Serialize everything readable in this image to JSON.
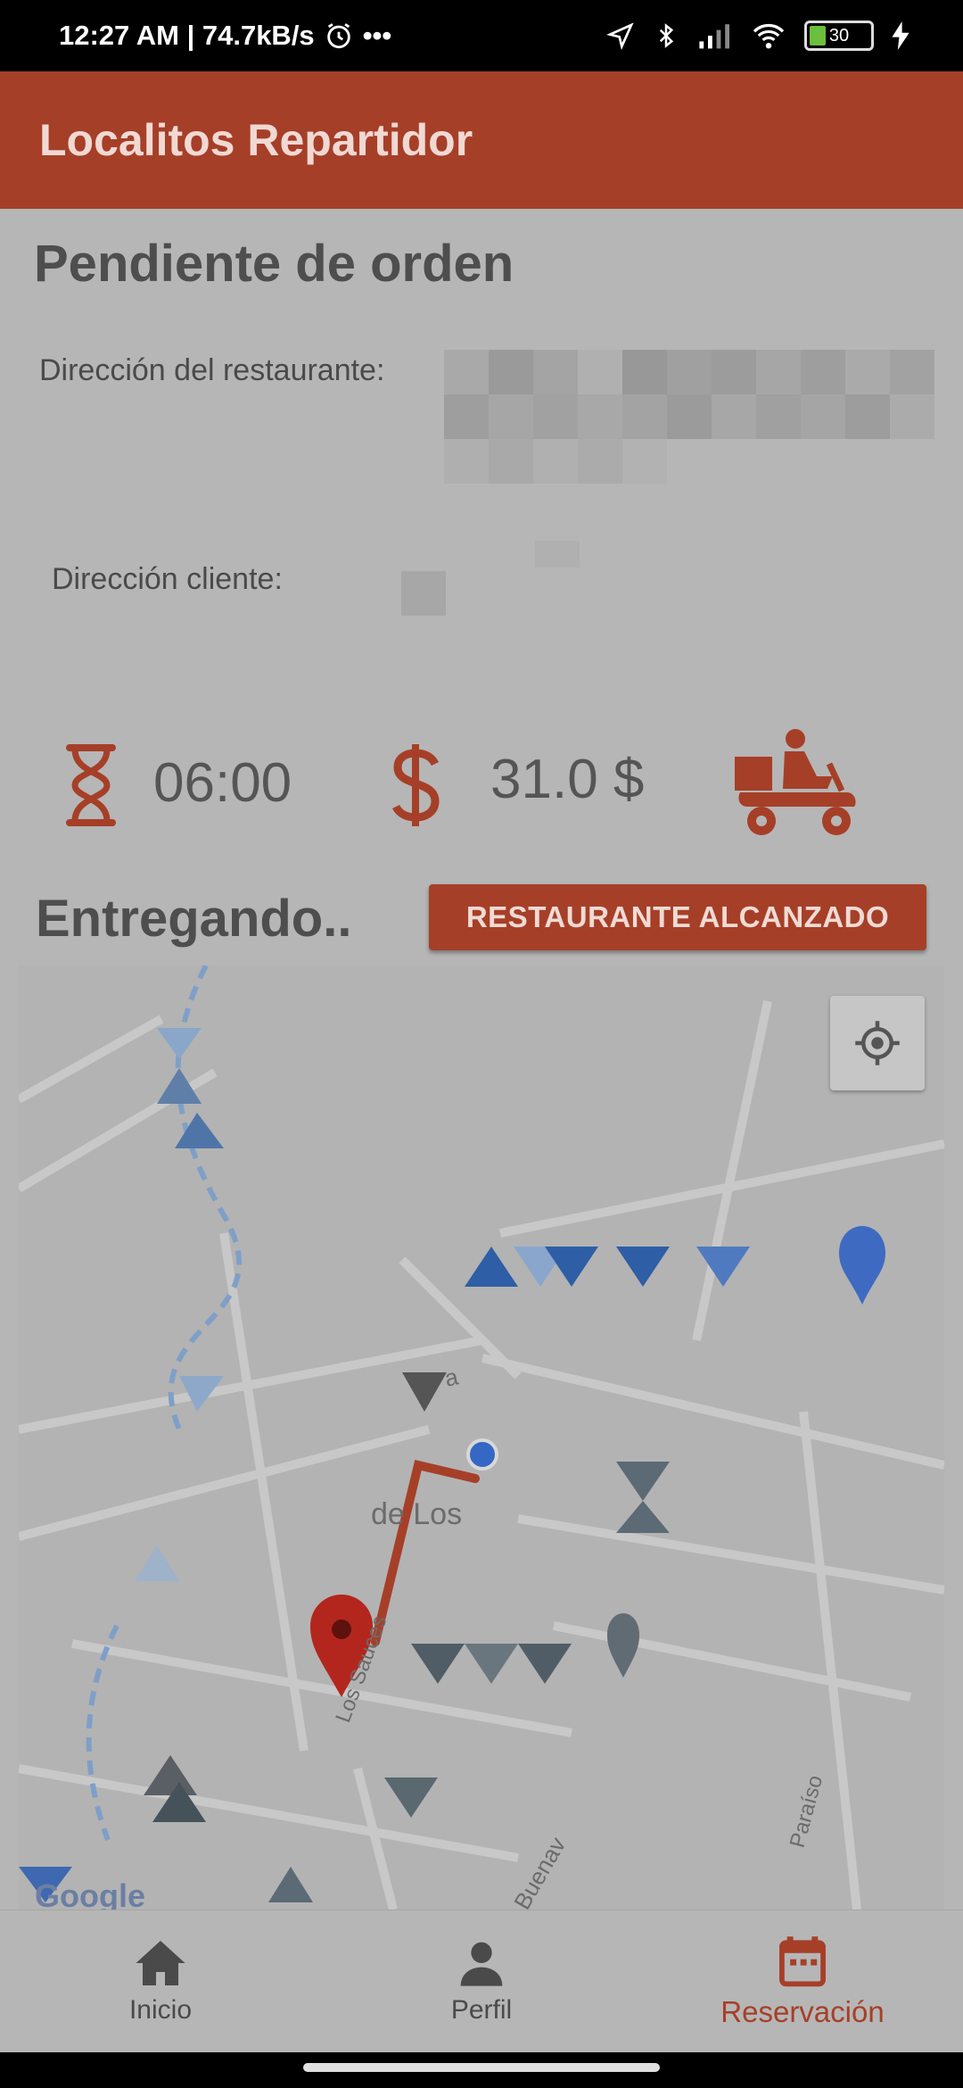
{
  "status_bar": {
    "time": "12:27 AM | 74.7kB/s",
    "more": "•••",
    "battery": "30",
    "icons": [
      "alarm-icon",
      "location-arrow-icon",
      "bluetooth-icon",
      "signal-icon",
      "wifi-icon",
      "battery-icon",
      "charging-icon"
    ]
  },
  "app_bar": {
    "title": "Localitos Repartidor"
  },
  "order": {
    "title": "Pendiente de orden",
    "restaurant_label": "Dirección del restaurante:",
    "client_label": "Dirección cliente:",
    "time_value": "06:00",
    "price_value": "31.0 $",
    "icons": [
      "hourglass-icon",
      "dollar-icon",
      "delivery-scooter-icon"
    ]
  },
  "delivery": {
    "title": "Entregando..",
    "reach_button": "RESTAURANTE ALCANZADO"
  },
  "map": {
    "labels": [
      "de Los",
      "Paraíso",
      "Buenav",
      "Los Sauces",
      "a"
    ],
    "google_logo": "Google",
    "colors": {
      "route": "#a63f28",
      "pin": "#b3261e",
      "current_location": "#3567c4"
    }
  },
  "bottom_nav": {
    "items": [
      {
        "label": "Inicio",
        "icon": "home-icon"
      },
      {
        "label": "Perfil",
        "icon": "person-icon"
      },
      {
        "label": "Reservación",
        "icon": "calendar-icon"
      }
    ],
    "active": "Reservación"
  },
  "colors": {
    "accent": "#a63f28",
    "overlay_bg": "#b6b6b6"
  }
}
